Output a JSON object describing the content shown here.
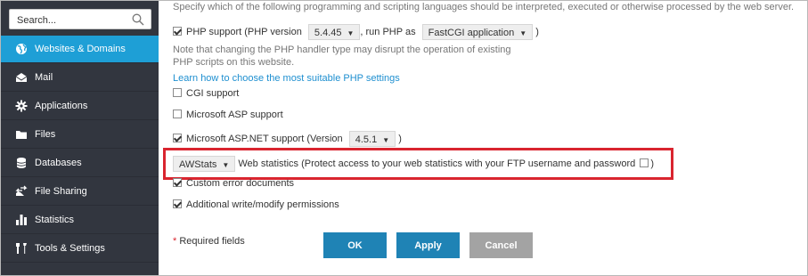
{
  "sidebar": {
    "search": {
      "placeholder": "Search..."
    },
    "items": [
      {
        "label": "Websites & Domains",
        "icon": "globe-icon",
        "active": true
      },
      {
        "label": "Mail",
        "icon": "envelope-icon"
      },
      {
        "label": "Applications",
        "icon": "gear-icon"
      },
      {
        "label": "Files",
        "icon": "folder-icon"
      },
      {
        "label": "Databases",
        "icon": "database-icon"
      },
      {
        "label": "File Sharing",
        "icon": "share-icon"
      },
      {
        "label": "Statistics",
        "icon": "bar-chart-icon"
      },
      {
        "label": "Tools & Settings",
        "icon": "tools-icon"
      }
    ]
  },
  "main": {
    "intro": "Specify which of the following programming and scripting languages should be interpreted, executed or otherwise processed by the web server.",
    "php": {
      "label_prefix": "PHP support (PHP version",
      "version": "5.4.45",
      "label_middle": ", run PHP as",
      "handler": "FastCGI application",
      "label_suffix": ")",
      "checked": true
    },
    "php_note_line1": "Note that changing the PHP handler type may disrupt the operation of existing",
    "php_note_line2": "PHP scripts on this website.",
    "php_link": "Learn how to choose the most suitable PHP settings",
    "cgi": {
      "label": "CGI support",
      "checked": false
    },
    "asp": {
      "label": "Microsoft ASP support",
      "checked": false
    },
    "aspnet": {
      "label_prefix": "Microsoft ASP.NET support (Version",
      "version": "4.5.1",
      "label_suffix": ")",
      "checked": true
    },
    "webstats": {
      "selected": "AWStats",
      "label": "Web statistics (Protect access to your web statistics with your FTP username and password",
      "label_suffix": ")",
      "protect_checked": false
    },
    "custom_errors": {
      "label": "Custom error documents",
      "checked": true
    },
    "write_perms": {
      "label": "Additional write/modify permissions",
      "checked": true
    },
    "required_star": "*",
    "required_label": "Required fields",
    "buttons": {
      "ok": "OK",
      "apply": "Apply",
      "cancel": "Cancel"
    }
  },
  "colors": {
    "sidebar_bg": "#32363f",
    "active_item": "#1e9fd6",
    "primary_button": "#1f83b5",
    "cancel_button": "#a3a3a3",
    "highlight_border": "#d9252f",
    "link": "#1e8fd0"
  }
}
